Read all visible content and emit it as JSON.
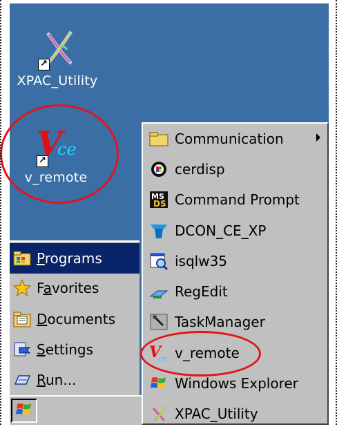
{
  "desktop": {
    "icons": [
      {
        "label": "XPAC_Utility",
        "icon": "xpac-utility-icon"
      },
      {
        "label": "v_remote",
        "icon": "v-remote-icon"
      }
    ]
  },
  "start_menu": {
    "items": [
      {
        "label": "Programs",
        "underline": "P",
        "rest": "rograms",
        "icon": "programs-folder-icon",
        "selected": true
      },
      {
        "label": "Favorites",
        "pre": "F",
        "underline": "a",
        "rest": "vorites",
        "icon": "favorites-star-icon"
      },
      {
        "label": "Documents",
        "underline": "D",
        "rest": "ocuments",
        "icon": "documents-folder-icon"
      },
      {
        "label": "Settings",
        "underline": "S",
        "rest": "ettings",
        "icon": "settings-icon"
      },
      {
        "label": "Run...",
        "underline": "R",
        "rest": "un...",
        "icon": "run-icon"
      }
    ]
  },
  "programs_submenu": {
    "items": [
      {
        "label": "Communication",
        "icon": "folder-icon",
        "has_submenu": true
      },
      {
        "label": "cerdisp",
        "icon": "cerdisp-icon"
      },
      {
        "label": "Command Prompt",
        "icon": "command-prompt-icon"
      },
      {
        "label": "DCON_CE_XP",
        "icon": "dcon-icon"
      },
      {
        "label": "isqlw35",
        "icon": "isqlw-icon"
      },
      {
        "label": "RegEdit",
        "icon": "regedit-icon"
      },
      {
        "label": "TaskManager",
        "icon": "task-manager-icon"
      },
      {
        "label": "v_remote",
        "icon": "v-remote-icon"
      },
      {
        "label": "Windows Explorer",
        "icon": "windows-explorer-icon"
      },
      {
        "label": "XPAC_Utility",
        "icon": "xpac-utility-icon"
      }
    ]
  },
  "taskbar": {
    "start_icon": "windows-flag-icon"
  },
  "colors": {
    "desktop": "#3a6ea5",
    "menu": "#c0c0c0",
    "selection": "#0a246a",
    "annotation": "#e3141b"
  }
}
